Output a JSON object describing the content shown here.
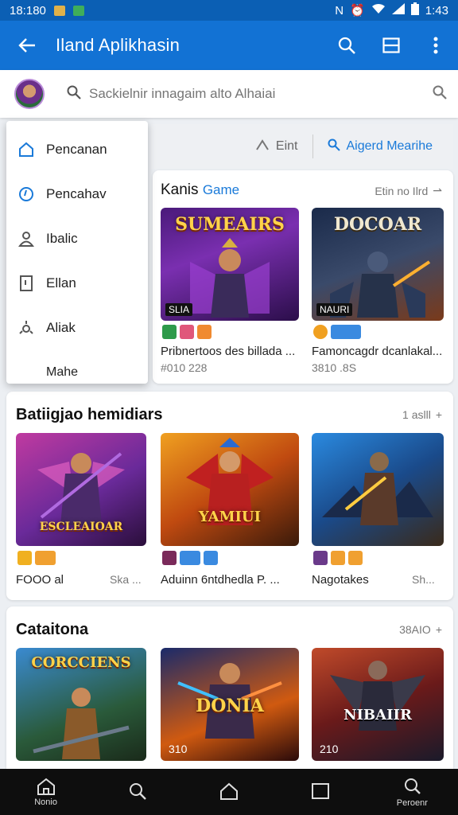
{
  "status": {
    "time_left": "18:180",
    "time_right": "1:43",
    "net": "N"
  },
  "appbar": {
    "title": "Iland Aplikhasin"
  },
  "search": {
    "placeholder": "Sackielnir innagaim alto Alhaiai"
  },
  "filters": {
    "sort_label": "Eint",
    "advanced_label": "Aigerd Mearihe"
  },
  "drawer": {
    "items": [
      {
        "label": "Pencanan",
        "icon": "home-icon"
      },
      {
        "label": "Pencahav",
        "icon": "clock-icon"
      },
      {
        "label": "Ibalic",
        "icon": "user-icon"
      },
      {
        "label": "Ellan",
        "icon": "bookmark-icon"
      },
      {
        "label": "Aliak",
        "icon": "settings-icon"
      },
      {
        "label": "Mahe",
        "icon": ""
      }
    ]
  },
  "featured": {
    "title_dark": "Kanis",
    "title_accent": "Game",
    "more": "Etin no Ilrd",
    "apps": [
      {
        "logo": "SUMEAIRS",
        "name": "Pribnertoos des billada ...",
        "meta": "#010 228",
        "tag": "SLIA"
      },
      {
        "logo": "DOCOAR",
        "name": "Famoncagdr dcanlakal...",
        "meta": "3810 .8S",
        "tag": "NAURI"
      }
    ]
  },
  "section2": {
    "title": "Batiigjao hemidiars",
    "more": "1 aslll",
    "apps": [
      {
        "logo": "ESCLEAIOAR",
        "name": "FOOO al",
        "meta": "Ska ..."
      },
      {
        "logo": "YAMIUI",
        "name": "Aduinn 6ntdhedla P. ...",
        "meta": ""
      },
      {
        "logo": "",
        "name": "Nagotakes",
        "meta": "Sh..."
      }
    ]
  },
  "section3": {
    "title": "Cataitona",
    "more": "38AIO",
    "apps": [
      {
        "logo": "CORCCIENS",
        "tag": ""
      },
      {
        "logo": "DONIA",
        "tag": "310"
      },
      {
        "logo": "NIBAIIR",
        "tag": "210"
      }
    ]
  },
  "navbar": {
    "items": [
      {
        "label": "Nonio"
      },
      {
        "label": ""
      },
      {
        "label": ""
      },
      {
        "label": ""
      },
      {
        "label": "Peroenr"
      }
    ]
  },
  "colors": {
    "primary": "#1272d4",
    "statusbar": "#0b5fb4",
    "accent": "#1a7ad9"
  }
}
